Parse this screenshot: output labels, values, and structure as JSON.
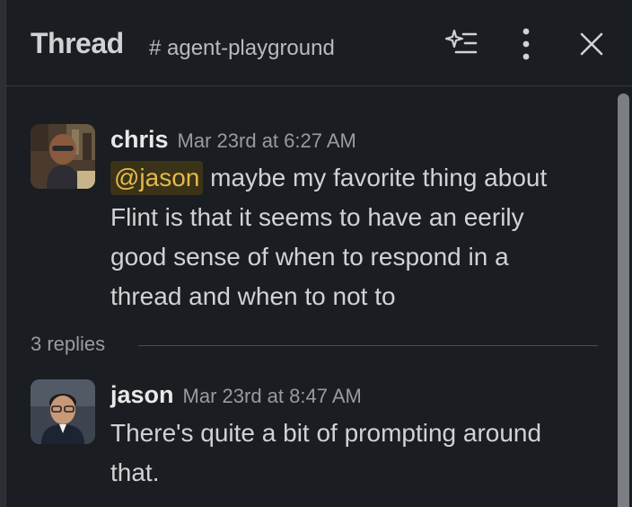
{
  "header": {
    "title": "Thread",
    "channel": "# agent-playground",
    "icons": [
      "sparkle-list-icon",
      "more-vertical-icon",
      "close-icon"
    ]
  },
  "messages": [
    {
      "author": "chris",
      "timestamp": "Mar 23rd at 6:27 AM",
      "mention": "@jason",
      "text_after_mention": " maybe my favorite thing about",
      "lines": [
        "Flint is that it seems to have an eerily",
        "good sense of when to respond in a",
        "thread and when to not to"
      ]
    },
    {
      "author": "jason",
      "timestamp": "Mar 23rd at 8:47 AM",
      "lines": [
        "There's quite a bit of prompting around",
        "that."
      ]
    }
  ],
  "replies_label": "3 replies",
  "colors": {
    "background": "#1a1d21",
    "mention_bg": "#3a3318",
    "mention_text": "#e5b84b",
    "muted": "#9a9b9e"
  }
}
